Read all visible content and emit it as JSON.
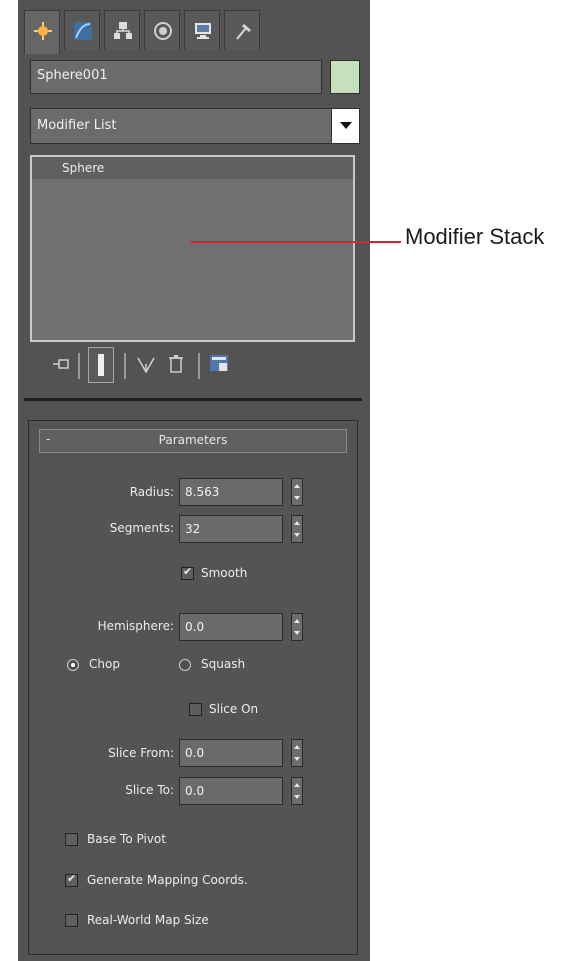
{
  "command_panel": {
    "tabs": [
      {
        "name": "create",
        "icon": "create-star-icon",
        "active": true
      },
      {
        "name": "modify",
        "icon": "modify-curve-icon",
        "active": false
      },
      {
        "name": "hierarchy",
        "icon": "hierarchy-icon",
        "active": false
      },
      {
        "name": "motion",
        "icon": "motion-icon",
        "active": false
      },
      {
        "name": "display",
        "icon": "display-monitor-icon",
        "active": false
      },
      {
        "name": "utilities",
        "icon": "utilities-hammer-icon",
        "active": false
      }
    ],
    "object_name": "Sphere001",
    "object_color": "#c6e0bd",
    "modifier_list": {
      "label": "Modifier List"
    },
    "modifier_stack": {
      "items": [
        "Sphere"
      ]
    },
    "parameters": {
      "title": "Parameters",
      "collapse_symbol": "-",
      "radius_label": "Radius:",
      "radius_value": "8.563",
      "segments_label": "Segments:",
      "segments_value": "32",
      "smooth_label": "Smooth",
      "smooth_checked": true,
      "hemisphere_label": "Hemisphere:",
      "hemisphere_value": "0.0",
      "chop_label": "Chop",
      "chop_selected": true,
      "squash_label": "Squash",
      "squash_selected": false,
      "slice_on_label": "Slice On",
      "slice_on_checked": false,
      "slice_from_label": "Slice From:",
      "slice_from_value": "0.0",
      "slice_to_label": "Slice To:",
      "slice_to_value": "0.0",
      "base_to_pivot_label": "Base To Pivot",
      "base_to_pivot_checked": false,
      "generate_mapping_label": "Generate Mapping Coords.",
      "generate_mapping_checked": true,
      "real_world_map_label": "Real-World Map Size",
      "real_world_map_checked": false
    }
  },
  "annotation": {
    "text": "Modifier Stack",
    "line_color": "#e31d2c"
  }
}
